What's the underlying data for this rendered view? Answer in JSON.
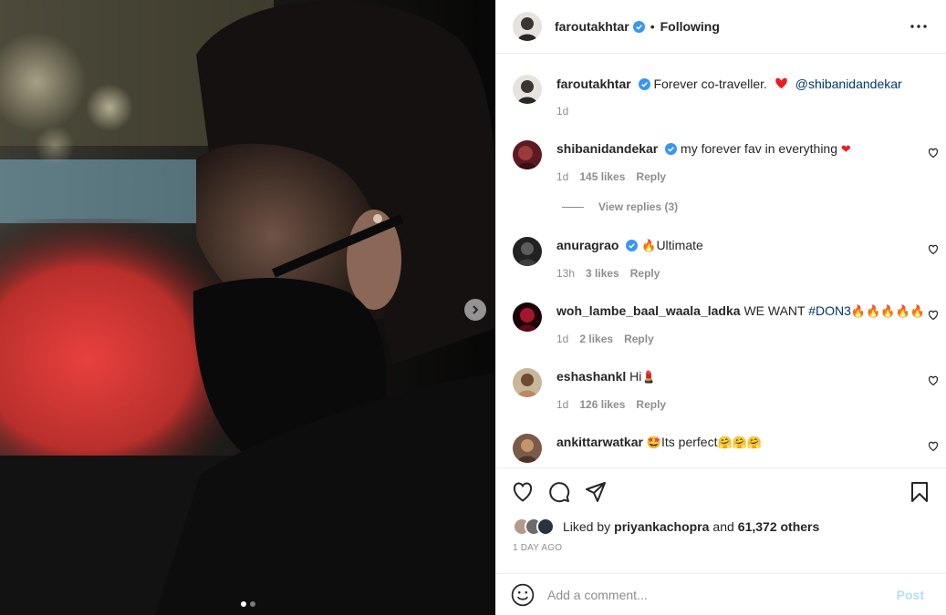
{
  "post": {
    "author": "faroutakhtar",
    "separator": "•",
    "follow_status": "Following",
    "caption_text": "Forever co-traveller.",
    "caption_mention": "@shibanidandekar",
    "caption_time": "1d"
  },
  "comments": [
    {
      "user": "shibanidandekar",
      "verified": true,
      "text": "my forever fav in everything",
      "emoji": "❤",
      "time": "1d",
      "likes": "145 likes",
      "reply": "Reply"
    },
    {
      "user": "anuragrao",
      "verified": true,
      "emoji_prefix": "🔥",
      "text": "Ultimate",
      "time": "13h",
      "likes": "3 likes",
      "reply": "Reply"
    },
    {
      "user": "woh_lambe_baal_waala_ladka",
      "verified": false,
      "text": "WE WANT",
      "hashtag": "#DON3",
      "emoji": "🔥🔥🔥🔥🔥",
      "time": "1d",
      "likes": "2 likes",
      "reply": "Reply"
    },
    {
      "user": "eshashankl",
      "verified": false,
      "text": "Hi",
      "emoji": "💄",
      "time": "1d",
      "likes": "126 likes",
      "reply": "Reply"
    },
    {
      "user": "ankittarwatkar",
      "verified": false,
      "emoji_prefix": "🤩",
      "text": "Its perfect",
      "emoji": "🤗🤗🤗",
      "time": "",
      "likes": "",
      "reply": ""
    }
  ],
  "view_replies": "View replies (3)",
  "likes_line": {
    "prefix": "Liked by",
    "user": "priyankachopra",
    "middle": "and",
    "count": "61,372 others"
  },
  "posted_time": "1 DAY AGO",
  "add_comment": {
    "placeholder": "Add a comment...",
    "post_label": "Post"
  },
  "carousel": {
    "total": 2,
    "active": 1
  },
  "colors": {
    "verified": "#3897f0",
    "heart_red": "#ed4956",
    "link": "#00376b",
    "post_disabled": "#b2dffc",
    "muted": "#8e8e8e"
  },
  "icons": [
    "more-icon",
    "heart-icon",
    "comment-icon",
    "share-icon",
    "bookmark-icon",
    "emoji-icon",
    "chevron-right-icon",
    "verified-icon"
  ]
}
